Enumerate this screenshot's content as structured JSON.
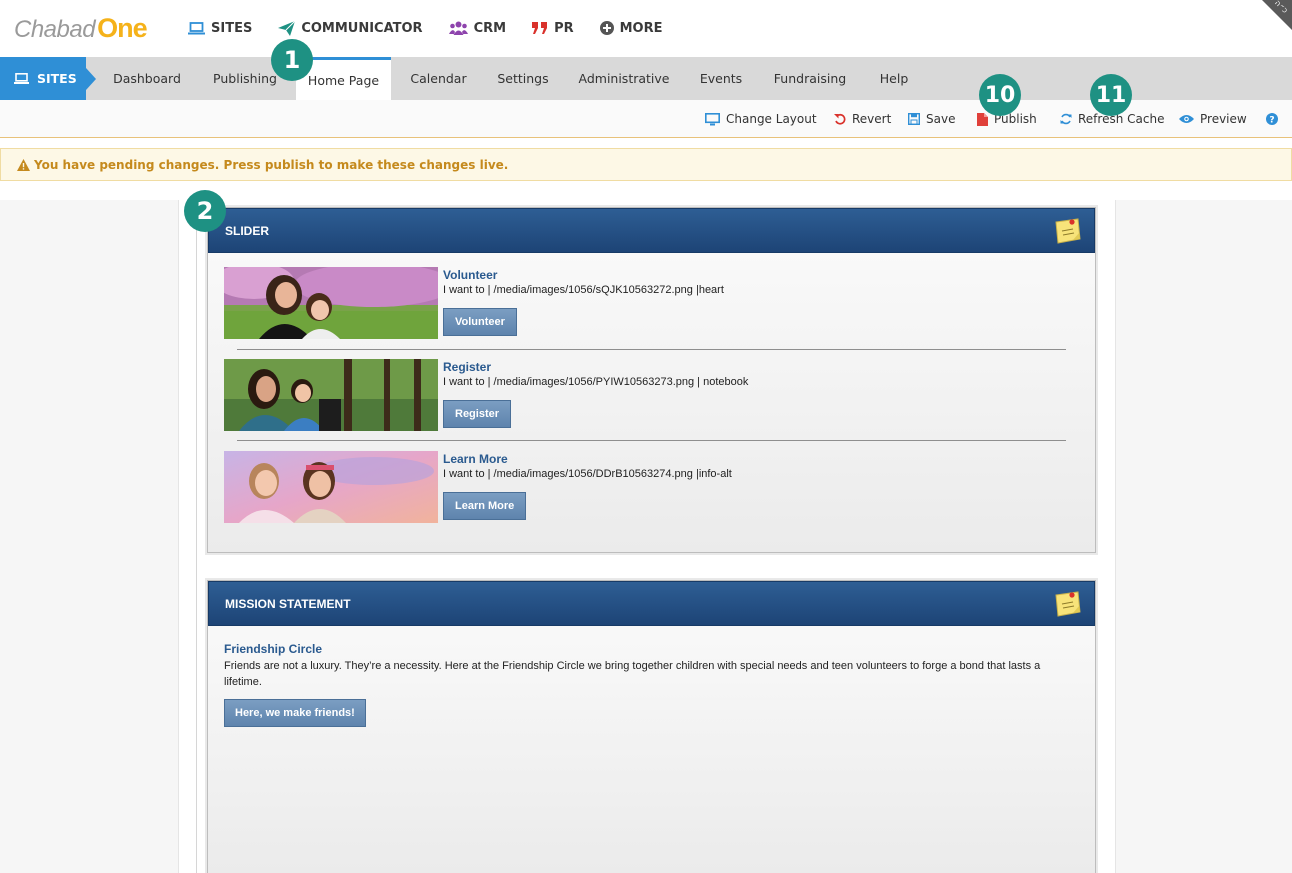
{
  "brand": {
    "name_part1": "Chabad",
    "name_part2": "One",
    "accent_color": "#f5b21a"
  },
  "corner_tag": "כ״ה",
  "top_nav": [
    {
      "label": "SITES",
      "icon": "laptop-icon",
      "color": "#2f8fd6"
    },
    {
      "label": "COMMUNICATOR",
      "icon": "paper-plane-icon",
      "color": "#1e9183"
    },
    {
      "label": "CRM",
      "icon": "users-icon",
      "color": "#8e44ad"
    },
    {
      "label": "PR",
      "icon": "quote-icon",
      "color": "#d9312b"
    },
    {
      "label": "MORE",
      "icon": "plus-circle-icon",
      "color": "#555555"
    }
  ],
  "sub_nav": {
    "section_label": "SITES",
    "tabs": [
      "Dashboard",
      "Publishing",
      "Home Page",
      "Calendar",
      "Settings",
      "Administrative",
      "Events",
      "Fundraising",
      "Help"
    ],
    "active_tab": "Home Page"
  },
  "toolbar": {
    "change_layout": "Change Layout",
    "revert": "Revert",
    "save": "Save",
    "publish": "Publish",
    "refresh_cache": "Refresh Cache",
    "preview": "Preview"
  },
  "alert": {
    "message": "You have pending changes. Press publish to make these changes live."
  },
  "callouts": {
    "c1": "1",
    "c2": "2",
    "c10": "10",
    "c11": "11"
  },
  "slider": {
    "title": "SLIDER",
    "slides": [
      {
        "title": "Volunteer",
        "text": "I want to | /media/images/1056/sQJK10563272.png |heart",
        "button": "Volunteer"
      },
      {
        "title": "Register",
        "text": "I want to | /media/images/1056/PYIW10563273.png | notebook",
        "button": "Register"
      },
      {
        "title": "Learn More",
        "text": "I want to | /media/images/1056/DDrB10563274.png |info-alt",
        "button": "Learn More"
      }
    ]
  },
  "mission": {
    "title": "MISSION STATEMENT",
    "heading": "Friendship Circle",
    "text": "Friends are not a luxury. They’re a necessity. Here at the Friendship Circle we bring together children with special needs and teen volunteers to forge a bond that lasts a lifetime.",
    "button": "Here, we make friends!"
  }
}
